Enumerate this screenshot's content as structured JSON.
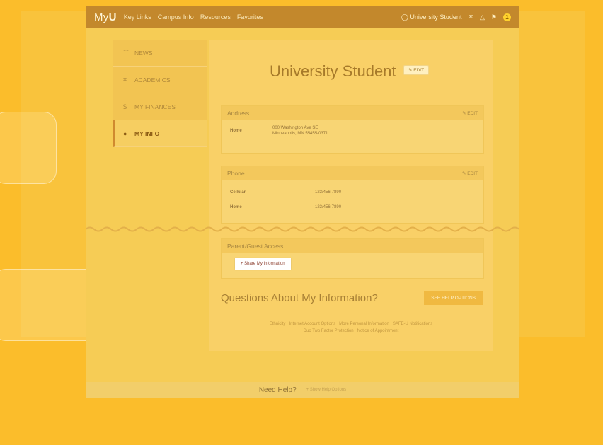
{
  "topbar": {
    "logo_prefix": "My",
    "logo_bold": "U",
    "links": [
      "Key Links",
      "Campus Info",
      "Resources",
      "Favorites"
    ],
    "user": "University Student",
    "notifications_count": "1"
  },
  "nav": {
    "items": [
      {
        "icon": "☷",
        "label": "NEWS"
      },
      {
        "icon": "⌗",
        "label": "ACADEMICS"
      },
      {
        "icon": "$",
        "label": "MY FINANCES"
      },
      {
        "icon": "●",
        "label": "MY INFO"
      }
    ]
  },
  "profile": {
    "name": "University Student",
    "edit_label": "✎ EDIT"
  },
  "address": {
    "title": "Address",
    "edit_label": "✎ EDIT",
    "rows": [
      {
        "key": "Home",
        "line1": "000 Washington Ave SE",
        "line2": "Minneapolis, MN 55455-0371"
      }
    ]
  },
  "phone": {
    "title": "Phone",
    "edit_label": "✎ EDIT",
    "rows": [
      {
        "key": "Cellular",
        "value": "123/456-7890"
      },
      {
        "key": "Home",
        "value": "123/456-7890"
      }
    ]
  },
  "guest": {
    "title": "Parent/Guest Access",
    "share_button": "+ Share My Information"
  },
  "questions": {
    "text": "Questions About My Information?",
    "button": "SEE HELP OPTIONS"
  },
  "links": {
    "line1": [
      "Ethnicity",
      "Internet Account Options",
      "More Personal Information",
      "SAFE-U Notifications"
    ],
    "line2": [
      "Duo Two Factor Protection",
      "Notice of Appointment"
    ]
  },
  "footer": {
    "need_help": "Need Help?",
    "show_options": "+ Show Help Options"
  },
  "colors": {
    "overlay": "#fbbd2b",
    "topbar": "#c3882c",
    "card": "#f9d067",
    "share_text": "#8b3c2c"
  }
}
